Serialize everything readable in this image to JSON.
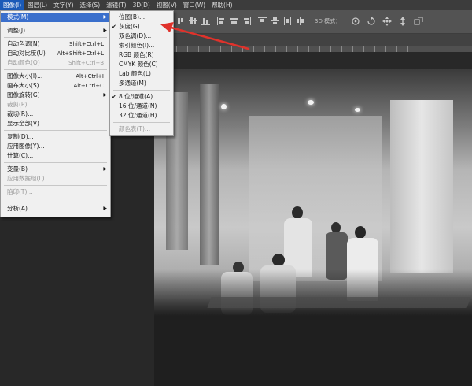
{
  "menubar": {
    "items": [
      "图像(I)",
      "图层(L)",
      "文字(Y)",
      "选择(S)",
      "滤镜(T)",
      "3D(D)",
      "视图(V)",
      "窗口(W)",
      "帮助(H)"
    ]
  },
  "options_bar": {
    "mode_3d_label": "3D 模式："
  },
  "image_menu": {
    "items": [
      {
        "label": "模式(M)",
        "has_submenu": true,
        "highlighted": true
      },
      {
        "label": "调整(J)",
        "has_submenu": true
      },
      {
        "label": "自动色调(N)",
        "shortcut": "Shift+Ctrl+L"
      },
      {
        "label": "自动对比度(U)",
        "shortcut": "Alt+Shift+Ctrl+L"
      },
      {
        "label": "自动颜色(O)",
        "shortcut": "Shift+Ctrl+B",
        "disabled": true
      },
      {
        "label": "图像大小(I)...",
        "shortcut": "Alt+Ctrl+I"
      },
      {
        "label": "画布大小(S)...",
        "shortcut": "Alt+Ctrl+C"
      },
      {
        "label": "图像旋转(G)",
        "has_submenu": true
      },
      {
        "label": "裁剪(P)",
        "disabled": true
      },
      {
        "label": "裁切(R)..."
      },
      {
        "label": "显示全部(V)"
      },
      {
        "label": "复制(D)..."
      },
      {
        "label": "应用图像(Y)..."
      },
      {
        "label": "计算(C)..."
      },
      {
        "label": "变量(B)",
        "has_submenu": true
      },
      {
        "label": "应用数据组(L)...",
        "disabled": true
      },
      {
        "label": "陷印(T)...",
        "disabled": true
      },
      {
        "label": "分析(A)",
        "has_submenu": true
      }
    ]
  },
  "mode_submenu": {
    "items": [
      {
        "label": "位图(B)..."
      },
      {
        "label": "灰度(G)",
        "checked": true
      },
      {
        "label": "双色调(D)..."
      },
      {
        "label": "索引颜色(I)..."
      },
      {
        "label": "RGB 颜色(R)"
      },
      {
        "label": "CMYK 颜色(C)"
      },
      {
        "label": "Lab 颜色(L)"
      },
      {
        "label": "多通道(M)"
      },
      {
        "label": "8 位/通道(A)",
        "checked": true
      },
      {
        "label": "16 位/通道(N)"
      },
      {
        "label": "32 位/通道(H)"
      },
      {
        "label": "颜色表(T)...",
        "disabled": true
      }
    ]
  },
  "colors": {
    "highlight": "#3a6fcc",
    "annotation_arrow": "#e0322b",
    "menubar_active": "#1a5ab8"
  }
}
